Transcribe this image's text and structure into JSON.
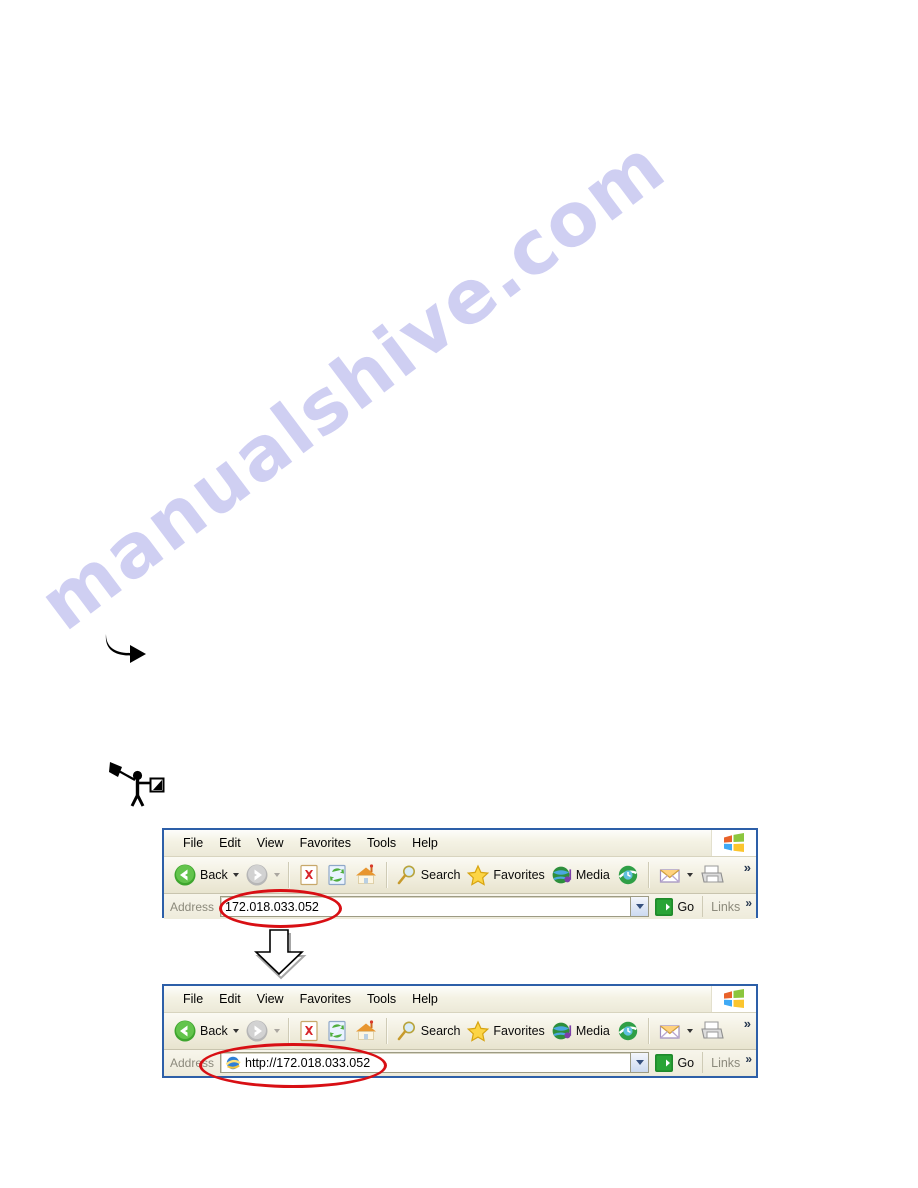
{
  "page": {
    "background": "#ffffff",
    "watermark": "manualshive.com",
    "watermark_color": "#cdcdf2"
  },
  "annotations": {
    "curved_arrow": "curved-arrow-right",
    "stick_figure": "stick-figure-with-flag",
    "down_arrow": "block-arrow-down",
    "highlight_color": "#d80f14"
  },
  "browsers": [
    {
      "id": "before",
      "menu": [
        "File",
        "Edit",
        "View",
        "Favorites",
        "Tools",
        "Help"
      ],
      "logo": "windows-flag-logo",
      "toolbar": {
        "back_label": "Back",
        "forward_label": "",
        "stop_label": "",
        "refresh_label": "",
        "home_label": "",
        "search_label": "Search",
        "favorites_label": "Favorites",
        "media_label": "Media",
        "history_label": "",
        "mail_label": "",
        "print_label": "",
        "overflow_label": "»"
      },
      "address": {
        "label": "Address",
        "value": "172.018.033.052",
        "placeholder": "172.018.033.052",
        "show_page_icon": false,
        "go_label": "Go",
        "links_label": "Links",
        "links_overflow": "»"
      }
    },
    {
      "id": "after",
      "menu": [
        "File",
        "Edit",
        "View",
        "Favorites",
        "Tools",
        "Help"
      ],
      "logo": "windows-flag-logo",
      "toolbar": {
        "back_label": "Back",
        "forward_label": "",
        "stop_label": "",
        "refresh_label": "",
        "home_label": "",
        "search_label": "Search",
        "favorites_label": "Favorites",
        "media_label": "Media",
        "history_label": "",
        "mail_label": "",
        "print_label": "",
        "overflow_label": "»"
      },
      "address": {
        "label": "Address",
        "value": "http://172.018.033.052",
        "placeholder": "http://172.018.033.052",
        "show_page_icon": true,
        "go_label": "Go",
        "links_label": "Links",
        "links_overflow": "»"
      }
    }
  ]
}
